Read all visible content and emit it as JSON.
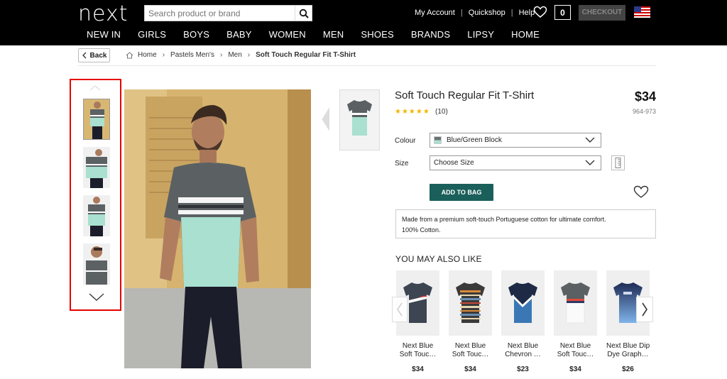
{
  "header": {
    "logo": "next",
    "search_placeholder": "Search product or brand",
    "links": [
      "My Account",
      "Quickshop",
      "Help"
    ],
    "bag_count": "0",
    "checkout_label": "CHECKOUT",
    "nav": [
      "NEW IN",
      "GIRLS",
      "BOYS",
      "BABY",
      "WOMEN",
      "MEN",
      "SHOES",
      "BRANDS",
      "LIPSY",
      "HOME"
    ]
  },
  "breadcrumb": {
    "back_label": "Back",
    "items": [
      "Home",
      "Pastels Men's",
      "Men"
    ],
    "current": "Soft Touch Regular Fit T-Shirt"
  },
  "product": {
    "title": "Soft Touch Regular Fit T-Shirt",
    "price": "$34",
    "rating_stars": "★★★★★",
    "rating": 5,
    "reviews": "(10)",
    "code": "964-973",
    "colour_label": "Colour",
    "colour_value": "Blue/Green Block",
    "size_label": "Size",
    "size_value": "Choose Size",
    "add_to_bag": "ADD TO BAG",
    "description": [
      "Made from a premium soft-touch Portuguese cotton for ultimate comfort.",
      "100% Cotton."
    ]
  },
  "recommendations": {
    "title": "YOU MAY ALSO LIKE",
    "items": [
      {
        "name1": "Next Blue",
        "name2": "Soft Touc…",
        "price": "$34"
      },
      {
        "name1": "Next Blue",
        "name2": "Soft Touc…",
        "price": "$34"
      },
      {
        "name1": "Next Blue",
        "name2": "Chevron …",
        "price": "$23"
      },
      {
        "name1": "Next Blue",
        "name2": "Soft Touc…",
        "price": "$34"
      },
      {
        "name1": "Next Blue Dip",
        "name2": "Dye Graph…",
        "price": "$26"
      }
    ]
  },
  "colors": {
    "header_bg": "#000000",
    "add_to_bag": "#1a5f5a",
    "highlight": "#e60000",
    "star": "#f2b600",
    "mint": "#a9e0cf",
    "charcoal": "#55595c"
  }
}
